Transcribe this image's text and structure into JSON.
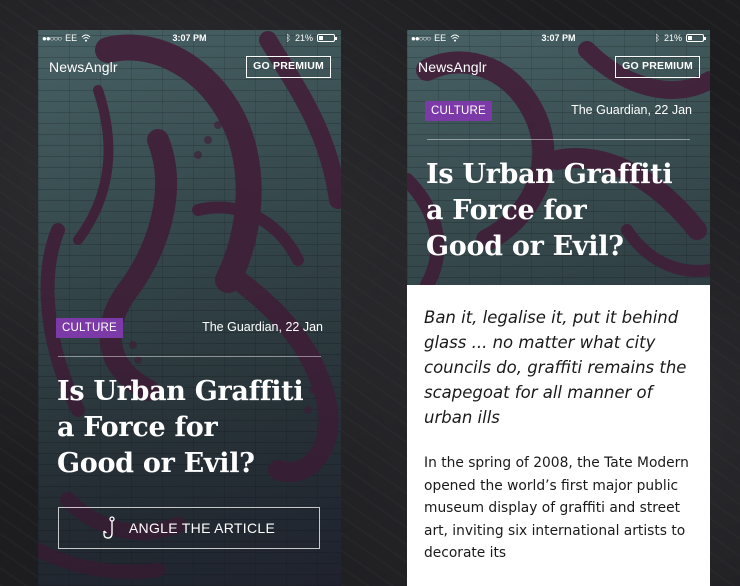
{
  "status_bar": {
    "carrier": "EE",
    "time": "3:07 PM",
    "battery": "21%"
  },
  "header": {
    "app_name": "NewsAnglr",
    "premium_label": "GO PREMIUM"
  },
  "article": {
    "category": "CULTURE",
    "source": "The Guardian, 22 Jan",
    "title_lines": [
      "Is Urban Graffiti",
      "a Force for",
      "Good or Evil?"
    ],
    "standfirst": "Ban it, legalise it, put it behind glass ... no matter what city councils do, graffiti remains the scapegoat for all manner of urban ills",
    "body": "In the spring of 2008, the Tate Modern opened the world’s first major public museum display of graffiti and street art, inviting six international artists to decorate its"
  },
  "actions": {
    "angle_label": "ANGLE THE ARTICLE",
    "angle_icon": "hook-icon"
  },
  "colors": {
    "tag_bg": "#7c3aa8",
    "overlay": "#4a2440",
    "background": "#1c1c1e"
  }
}
